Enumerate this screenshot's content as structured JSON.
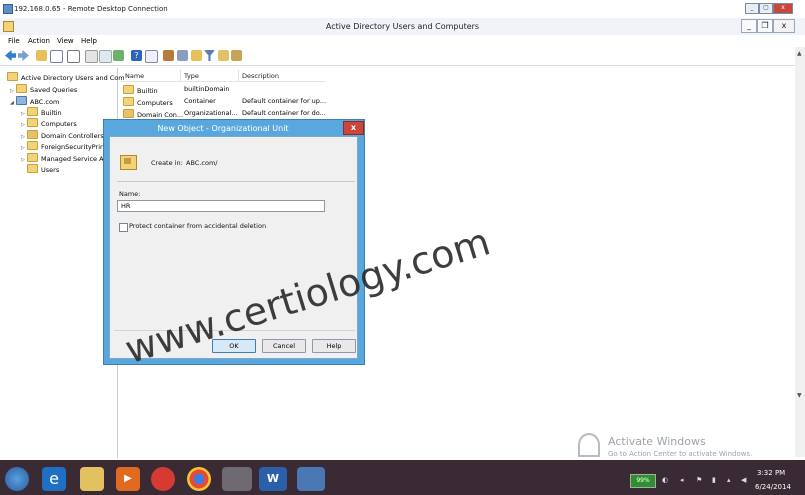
{
  "rdp": {
    "title": "192.168.0.65 - Remote Desktop Connection",
    "controls": [
      "_",
      "▢",
      "x"
    ]
  },
  "app": {
    "title": "Active Directory Users and Computers",
    "controls": [
      "_",
      "❐",
      "x"
    ]
  },
  "menu": [
    "File",
    "Action",
    "View",
    "Help"
  ],
  "tree": {
    "root": "Active Directory Users and Com",
    "saved_queries": "Saved Queries",
    "domain": "ABC.com",
    "children": [
      "Builtin",
      "Computers",
      "Domain Controllers",
      "ForeignSecurityPrin",
      "Managed Service A",
      "Users"
    ]
  },
  "list": {
    "columns": [
      "Name",
      "Type",
      "Description"
    ],
    "rows": [
      {
        "name": "Builtin",
        "type": "builtinDomain",
        "desc": ""
      },
      {
        "name": "Computers",
        "type": "Container",
        "desc": "Default container for up..."
      },
      {
        "name": "Domain Con...",
        "type": "Organizational...",
        "desc": "Default container for do..."
      }
    ]
  },
  "dialog": {
    "title": "New Object - Organizational Unit",
    "close": "x",
    "create_in_label": "Create in:",
    "create_in_value": "ABC.com/",
    "name_label": "Name:",
    "name_value": "HR",
    "protect_label": "Protect container from accidental deletion",
    "ok": "OK",
    "cancel": "Cancel",
    "help": "Help"
  },
  "watermark": "www.certiology.com",
  "activate": {
    "title": "Activate Windows",
    "subtitle": "Go to Action Center to activate Windows."
  },
  "taskbar": {
    "battery": "99%",
    "time": "3:32 PM",
    "date": "6/24/2014"
  },
  "colors": {
    "dialog_frame": "#59a7dc",
    "dialog_close": "#c9463d",
    "taskbar": "#3a2a34"
  }
}
